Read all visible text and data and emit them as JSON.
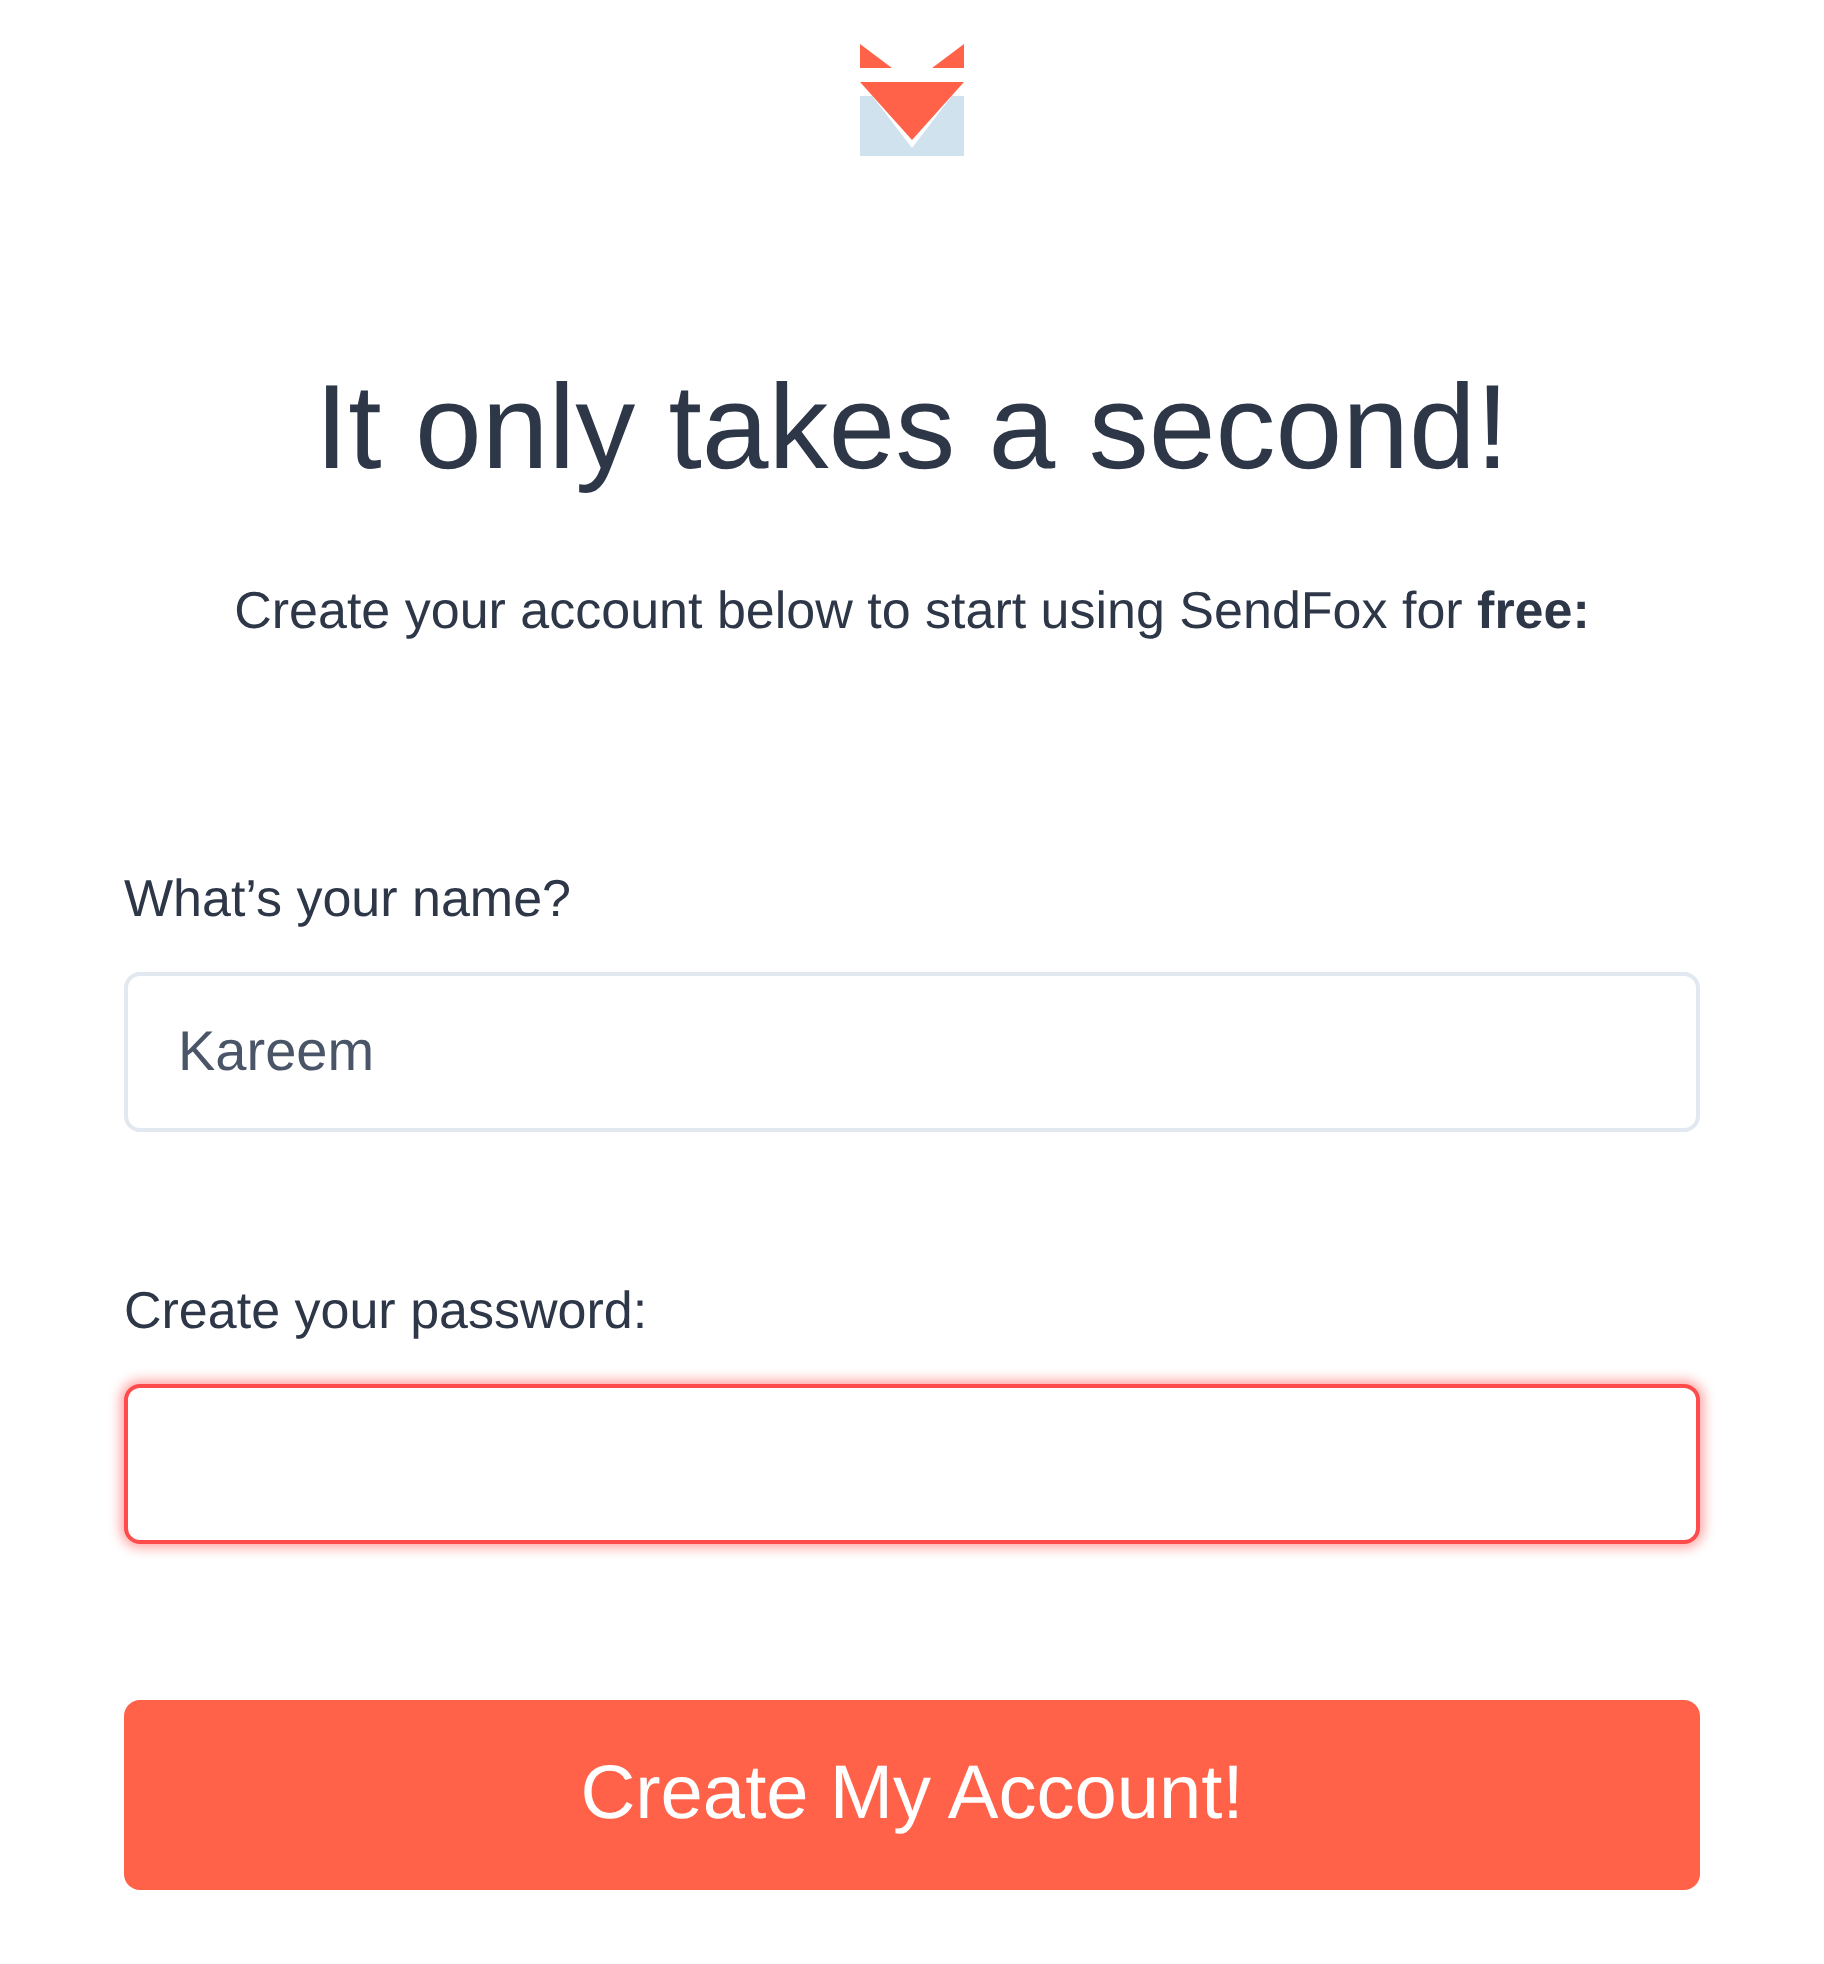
{
  "heading": "It only takes a second!",
  "subtitle": "Create your account below to start using SendFox for **free:**",
  "fields": [
    {
      "label": "What’s your name?",
      "value": "Kareem",
      "invalid": false
    },
    {
      "label": "Create your password:",
      "invalid": true
    }
  ],
  "submit_button": "Create My Account!"
}
